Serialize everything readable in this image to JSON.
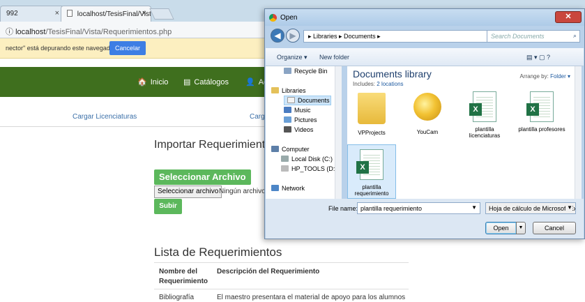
{
  "browser": {
    "tabs": [
      {
        "label": "992",
        "close": "×"
      },
      {
        "label": "localhost/TesisFinal/Vist",
        "close": "×"
      }
    ],
    "address": {
      "info_icon": "ⓘ",
      "host": "localhost",
      "path": "/TesisFinal/Vista/Requerimientos.php"
    },
    "infobar": {
      "message": "nector\" está depurando este navegador.",
      "button": "Cancelar"
    }
  },
  "site": {
    "nav": [
      {
        "icon": "home-icon",
        "glyph": "🏠",
        "label": "Inicio"
      },
      {
        "icon": "list-icon",
        "glyph": "▤",
        "label": "Catálogos"
      },
      {
        "icon": "user-icon",
        "glyph": "👤",
        "label": "Ac"
      }
    ],
    "subnav": [
      "Cargar Licenciaturas",
      "Carg"
    ],
    "import_title": "Importar Requerimientos",
    "select_file_button": "Seleccionar Archivo",
    "file_input_button": "Seleccionar archivo",
    "file_input_status": "Ningún archivo",
    "submit_button": "Subir",
    "list_title": "Lista de Requerimientos",
    "table": {
      "headers": [
        "Nombre del Requerimiento",
        "Descripción del Requerimiento"
      ],
      "rows": [
        [
          "Bibliografía",
          "El maestro presentara el material de apoyo para los alumnos"
        ]
      ]
    }
  },
  "dialog": {
    "title": "Open",
    "close": "✕",
    "back": "◀",
    "forward": "▶",
    "breadcrumb": "▸  Libraries  ▸  Documents  ▸",
    "search_placeholder": "Search Documents",
    "organize": "Organize ▾",
    "new_folder": "New folder",
    "view_icons": "▤ ▾   ▢   ?",
    "nav": [
      {
        "label": "Recycle Bin",
        "icon": "recycle-bin-icon"
      },
      {
        "label": "Libraries",
        "icon": "libraries-icon"
      },
      {
        "label": "Documents",
        "icon": "documents-icon"
      },
      {
        "label": "Music",
        "icon": "music-icon"
      },
      {
        "label": "Pictures",
        "icon": "pictures-icon"
      },
      {
        "label": "Videos",
        "icon": "videos-icon"
      },
      {
        "label": "Computer",
        "icon": "computer-icon"
      },
      {
        "label": "Local Disk (C:)",
        "icon": "disk-icon"
      },
      {
        "label": "HP_TOOLS (D:)",
        "icon": "disk-icon"
      },
      {
        "label": "Network",
        "icon": "network-icon"
      }
    ],
    "library_title": "Documents library",
    "library_includes_label": "Includes:",
    "library_includes_link": "2 locations",
    "arrange_label": "Arrange by:",
    "arrange_value": "Folder ▾",
    "items": [
      {
        "label": "VPProjects",
        "kind": "folder"
      },
      {
        "label": "YouCam",
        "kind": "folder-cam"
      },
      {
        "label": "plantilla licenciaturas",
        "kind": "excel"
      },
      {
        "label": "plantilla profesores",
        "kind": "excel"
      },
      {
        "label": "plantilla requerimiento",
        "kind": "excel",
        "selected": true
      }
    ],
    "file_name_label": "File name:",
    "file_name_value": "plantilla requerimiento",
    "file_type_value": "Hoja de cálculo de Microsoft Ex",
    "open_button": "Open",
    "cancel_button": "Cancel",
    "dropdown_arrow": "▼"
  }
}
